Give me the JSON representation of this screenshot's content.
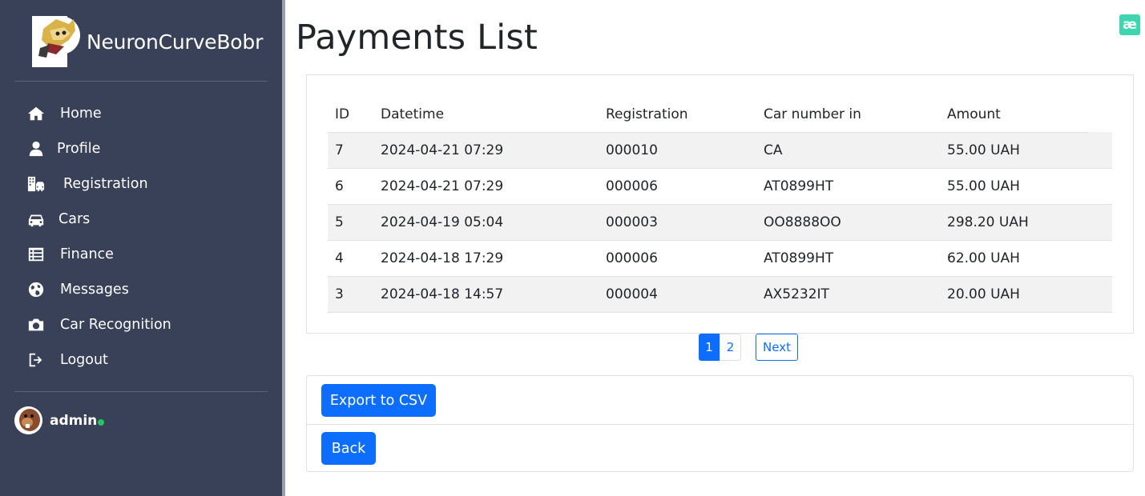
{
  "sidebar": {
    "brand_name": "NeuronCurveBobr",
    "items": [
      {
        "label": "Home",
        "icon": "home-icon"
      },
      {
        "label": "Profile",
        "icon": "user-icon"
      },
      {
        "label": "Registration",
        "icon": "building-car-icon"
      },
      {
        "label": "Cars",
        "icon": "car-icon"
      },
      {
        "label": "Finance",
        "icon": "list-icon"
      },
      {
        "label": "Messages",
        "icon": "globe-icon"
      },
      {
        "label": "Car Recognition",
        "icon": "camera-icon"
      },
      {
        "label": "Logout",
        "icon": "logout-icon"
      }
    ],
    "user": {
      "name": "admin",
      "status_color": "#22c55e"
    }
  },
  "page": {
    "title": "Payments List",
    "badge": "æ"
  },
  "table": {
    "headers": [
      "ID",
      "Datetime",
      "Registration",
      "Car number in",
      "Amount"
    ],
    "rows": [
      [
        "7",
        "2024-04-21 07:29",
        "000010",
        "CA",
        "55.00 UAH"
      ],
      [
        "6",
        "2024-04-21 07:29",
        "000006",
        "AT0899HT",
        "55.00 UAH"
      ],
      [
        "5",
        "2024-04-19 05:04",
        "000003",
        "OO8888OO",
        "298.20 UAH"
      ],
      [
        "4",
        "2024-04-18 17:29",
        "000006",
        "AT0899HT",
        "62.00 UAH"
      ],
      [
        "3",
        "2024-04-18 14:57",
        "000004",
        "AX5232IT",
        "20.00 UAH"
      ]
    ]
  },
  "pagination": {
    "pages": [
      "1",
      "2"
    ],
    "active": "1",
    "next_label": "Next"
  },
  "actions": {
    "export_label": "Export to CSV",
    "back_label": "Back"
  },
  "colors": {
    "sidebar_bg": "#394158",
    "primary": "#0d6efd",
    "badge": "#3dd6b0"
  }
}
